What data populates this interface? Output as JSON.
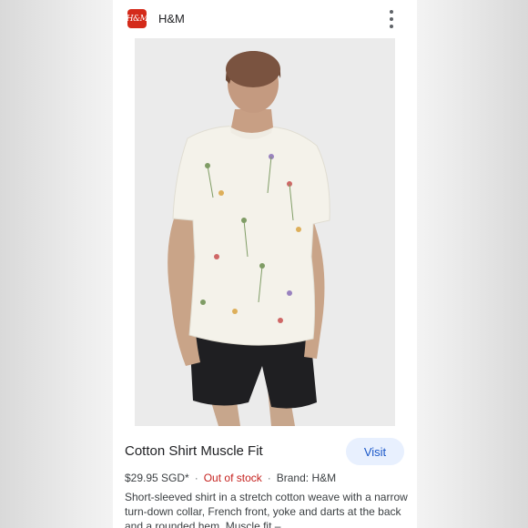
{
  "header": {
    "logo_text": "H&M",
    "title": "H&M",
    "more_icon": "more-vert-icon"
  },
  "product": {
    "title": "Cotton Shirt Muscle Fit",
    "visit_label": "Visit",
    "price": "$29.95 SGD*",
    "stock": "Out of stock",
    "brand": "Brand: H&M",
    "separator": "·",
    "description": "Short-sleeved shirt in a stretch cotton weave with a narrow turn-down collar, French front, yoke and darts at the back and a rounded hem. Muscle fit – ..."
  },
  "colors": {
    "accent": "#1a57c8",
    "out_of_stock": "#c5221f",
    "logo_bg": "#d42a1a"
  }
}
